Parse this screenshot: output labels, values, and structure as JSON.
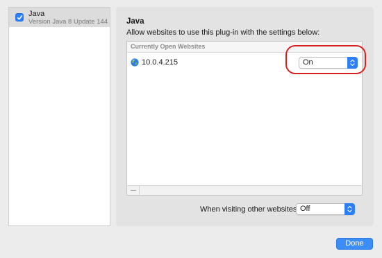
{
  "sidebar": {
    "plugins": [
      {
        "name": "Java",
        "version": "Version Java 8 Update 144...",
        "enabled": true
      }
    ]
  },
  "content": {
    "title": "Java",
    "description": "Allow websites to use this plug-in with the settings below:",
    "sites_table": {
      "header": "Currently Open Websites",
      "rows": [
        {
          "icon": "globe-icon",
          "address": "10.0.4.215",
          "setting": "On"
        }
      ],
      "footer_button": "remove"
    },
    "other_sites": {
      "label": "When visiting other websites:",
      "setting": "Off"
    }
  },
  "footer": {
    "done_label": "Done"
  },
  "colors": {
    "accent": "#2d7ff9",
    "highlight_ring": "#d92020",
    "sidebar_selected": "#dcdcdc",
    "panel_background": "#e3e3e3"
  }
}
